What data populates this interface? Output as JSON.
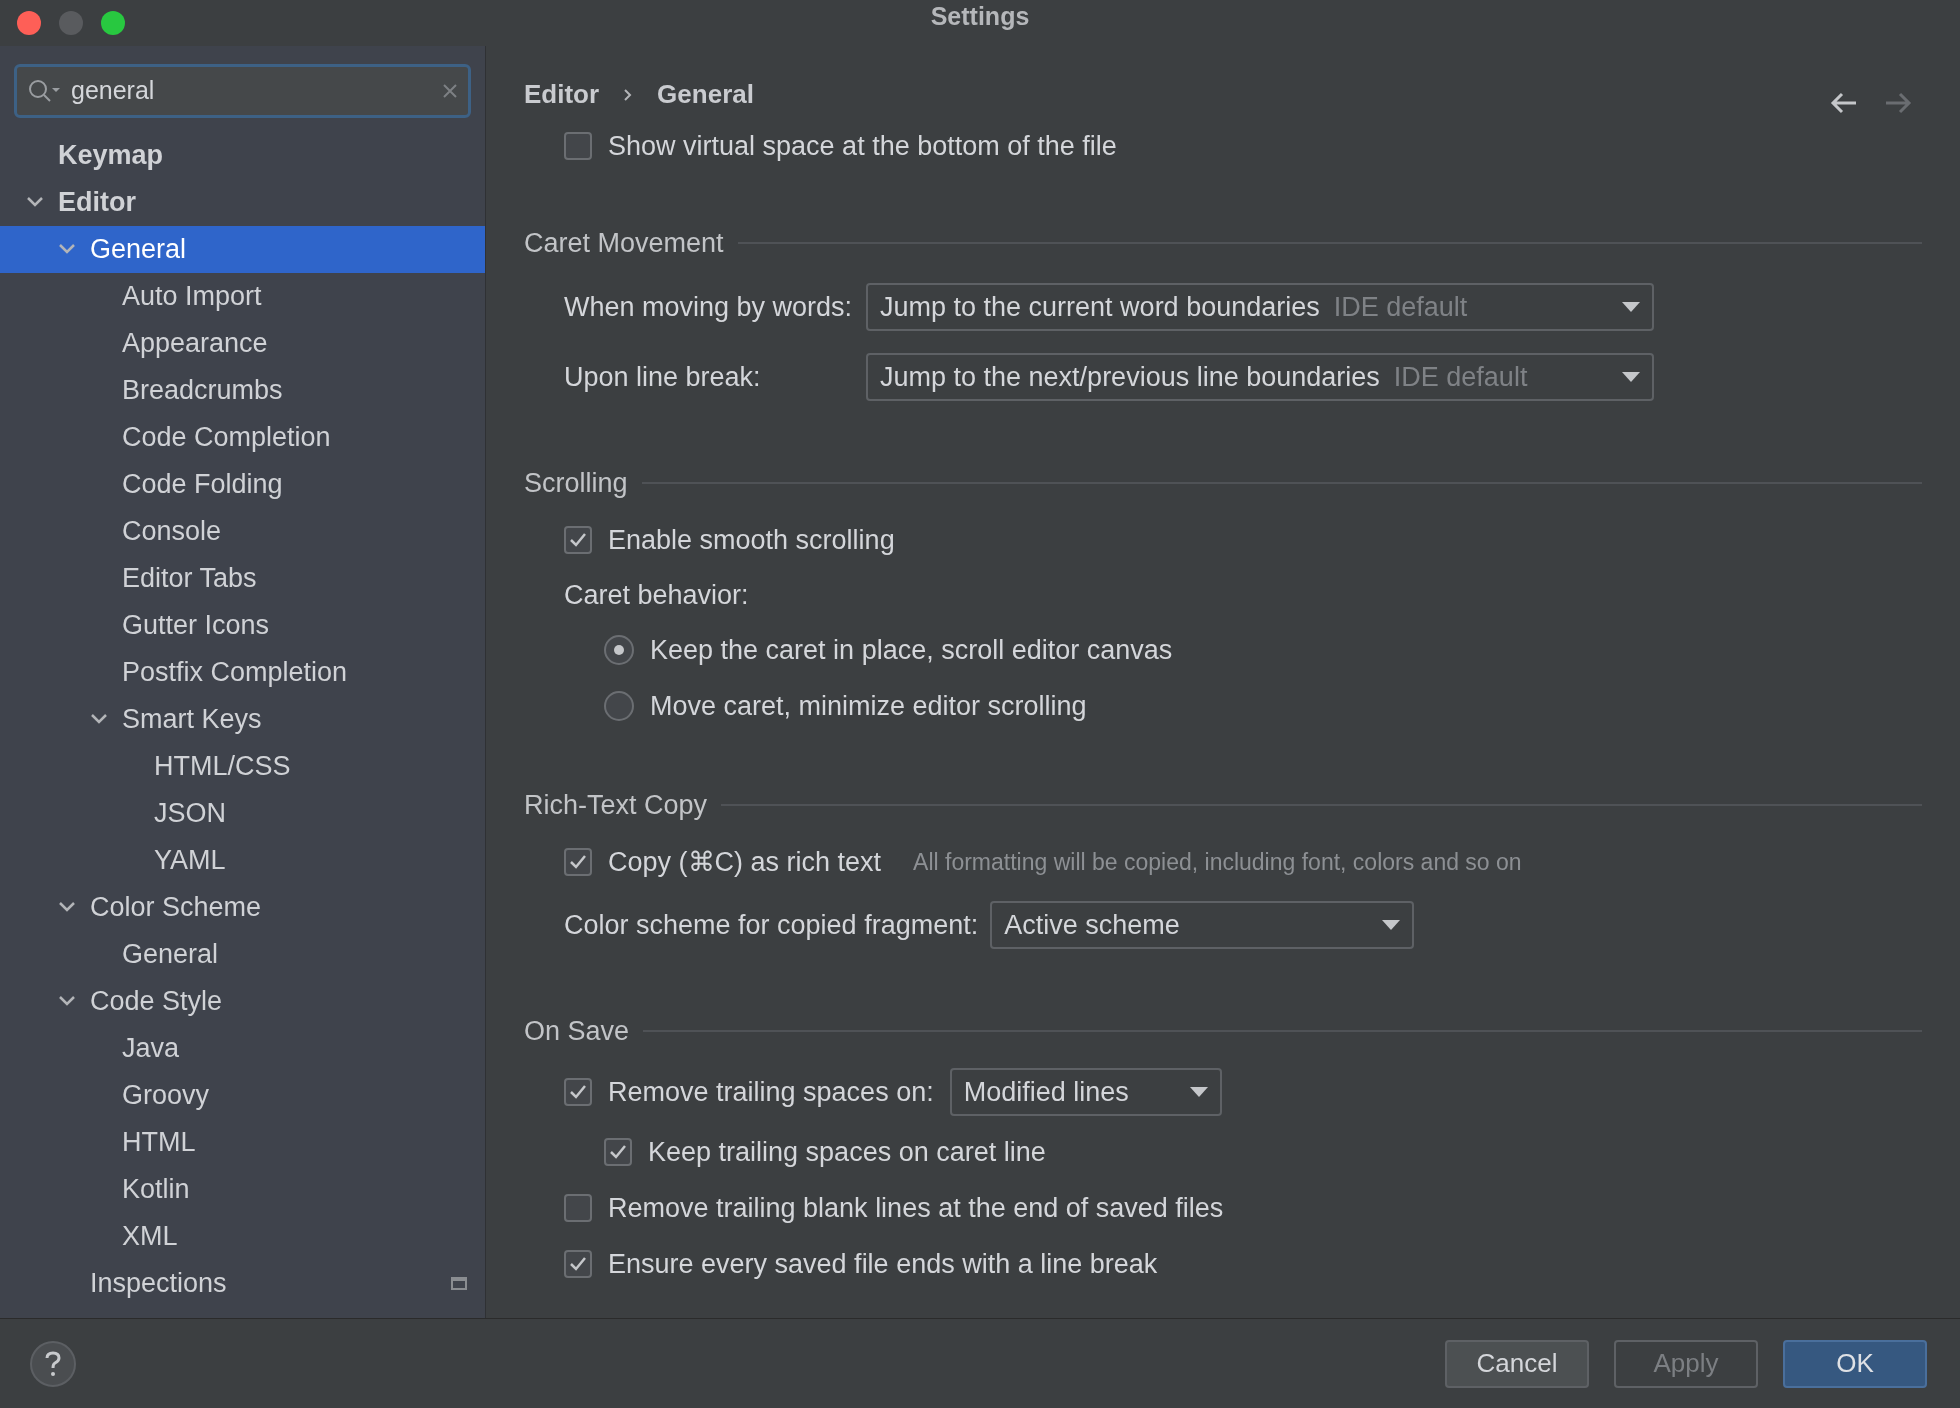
{
  "window": {
    "title": "Settings"
  },
  "search": {
    "value": "general"
  },
  "sidebar": {
    "items": [
      {
        "label": "Keymap",
        "selected": false
      },
      {
        "label": "Editor",
        "selected": false,
        "expanded": true,
        "children": [
          {
            "label": "General",
            "selected": true,
            "expanded": true,
            "children": [
              {
                "label": "Auto Import",
                "selected": false
              },
              {
                "label": "Appearance",
                "selected": false
              },
              {
                "label": "Breadcrumbs",
                "selected": false
              },
              {
                "label": "Code Completion",
                "selected": false
              },
              {
                "label": "Code Folding",
                "selected": false
              },
              {
                "label": "Console",
                "selected": false
              },
              {
                "label": "Editor Tabs",
                "selected": false
              },
              {
                "label": "Gutter Icons",
                "selected": false
              },
              {
                "label": "Postfix Completion",
                "selected": false
              },
              {
                "label": "Smart Keys",
                "selected": false,
                "expanded": true,
                "children": [
                  {
                    "label": "HTML/CSS",
                    "selected": false
                  },
                  {
                    "label": "JSON",
                    "selected": false
                  },
                  {
                    "label": "YAML",
                    "selected": false
                  }
                ]
              }
            ]
          },
          {
            "label": "Color Scheme",
            "selected": false,
            "expanded": true,
            "children": [
              {
                "label": "General",
                "selected": false
              }
            ]
          },
          {
            "label": "Code Style",
            "selected": false,
            "expanded": true,
            "children": [
              {
                "label": "Java",
                "selected": false
              },
              {
                "label": "Groovy",
                "selected": false
              },
              {
                "label": "HTML",
                "selected": false
              },
              {
                "label": "Kotlin",
                "selected": false
              },
              {
                "label": "XML",
                "selected": false
              }
            ]
          },
          {
            "label": "Inspections",
            "selected": false,
            "project_level": true
          }
        ]
      }
    ]
  },
  "breadcrumb": [
    "Editor",
    "General"
  ],
  "navigation": {
    "back_enabled": true,
    "forward_enabled": false
  },
  "content": [
    {
      "kind": "checkbox",
      "label": "Show virtual space at the bottom of the file",
      "checked": false
    },
    {
      "kind": "section",
      "label": "Caret Movement"
    },
    {
      "kind": "dropdown",
      "label": "When moving by words:",
      "value": "Jump to the current word boundaries",
      "hint": "IDE default"
    },
    {
      "kind": "dropdown",
      "label": "Upon line break:",
      "value": "Jump to the next/previous line boundaries",
      "hint": "IDE default"
    },
    {
      "kind": "section",
      "label": "Scrolling"
    },
    {
      "kind": "checkbox",
      "label": "Enable smooth scrolling",
      "checked": true
    },
    {
      "kind": "label",
      "label": "Caret behavior:",
      "children": [
        {
          "kind": "radio",
          "label": "Keep the caret in place, scroll editor canvas",
          "selected": true
        },
        {
          "kind": "radio",
          "label": "Move caret, minimize editor scrolling",
          "selected": false
        }
      ]
    },
    {
      "kind": "section",
      "label": "Rich-Text Copy"
    },
    {
      "kind": "checkbox",
      "label": "Copy (⌘C) as rich text",
      "checked": true,
      "hint": "All formatting will be copied, including font, colors and so on"
    },
    {
      "kind": "dropdown",
      "label": "Color scheme for copied fragment:",
      "value": "Active scheme"
    },
    {
      "kind": "section",
      "label": "On Save"
    },
    {
      "kind": "checkbox",
      "label": "Remove trailing spaces on:",
      "checked": true,
      "dropdown": "Modified lines",
      "children": [
        {
          "kind": "checkbox",
          "label": "Keep trailing spaces on caret line",
          "checked": true
        }
      ]
    },
    {
      "kind": "checkbox",
      "label": "Remove trailing blank lines at the end of saved files",
      "checked": false
    },
    {
      "kind": "checkbox",
      "label": "Ensure every saved file ends with a line break",
      "checked": true
    }
  ],
  "buttons": [
    {
      "label": "Cancel",
      "kind": "default"
    },
    {
      "label": "Apply",
      "kind": "disabled"
    },
    {
      "label": "OK",
      "kind": "primary"
    }
  ]
}
